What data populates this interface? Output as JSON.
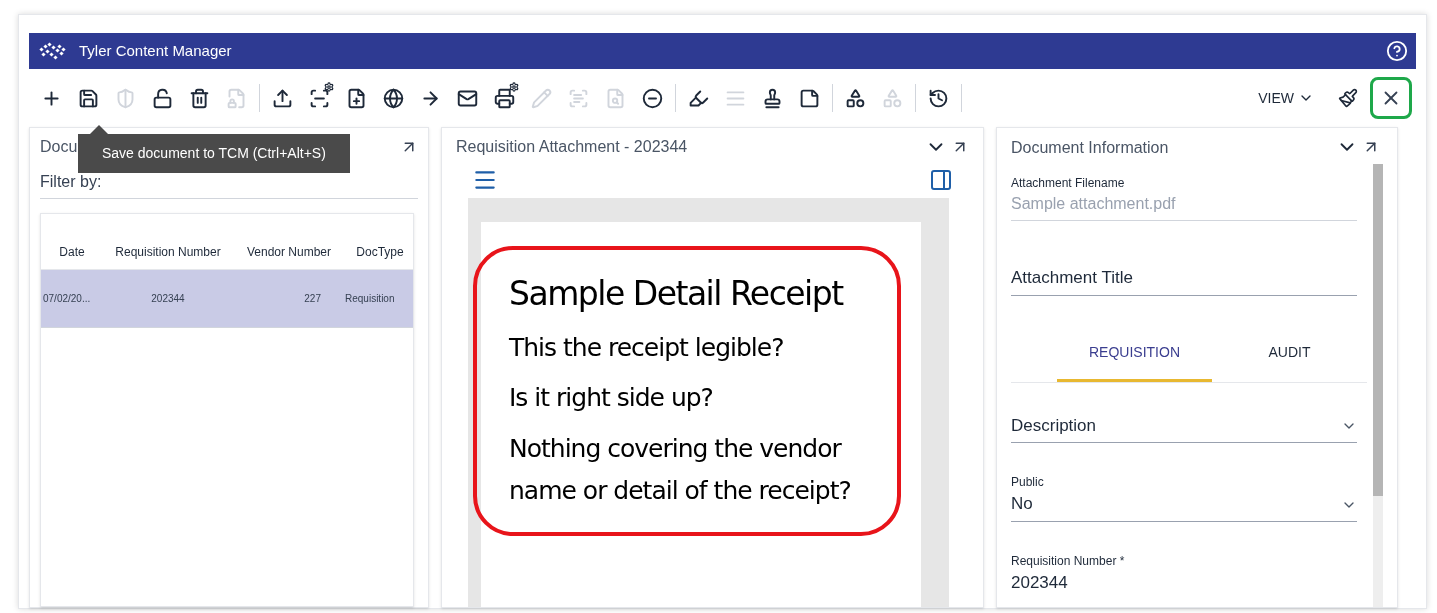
{
  "app": {
    "title": "Tyler Content Manager"
  },
  "toolbar": [
    {
      "kind": "add",
      "disabled": false
    },
    {
      "kind": "save",
      "disabled": false
    },
    {
      "kind": "shield",
      "disabled": true
    },
    {
      "kind": "unlock",
      "disabled": false
    },
    {
      "kind": "delete",
      "disabled": false
    },
    {
      "kind": "file-lock",
      "disabled": true
    },
    {
      "kind": "separator"
    },
    {
      "kind": "upload",
      "disabled": false
    },
    {
      "kind": "scan",
      "disabled": false
    },
    {
      "kind": "file-add",
      "disabled": false
    },
    {
      "kind": "globe",
      "disabled": false
    },
    {
      "kind": "arrow",
      "disabled": false
    },
    {
      "kind": "mail",
      "disabled": false
    },
    {
      "kind": "print",
      "disabled": false
    },
    {
      "kind": "pencil",
      "disabled": true
    },
    {
      "kind": "text-box",
      "disabled": true
    },
    {
      "kind": "search-doc",
      "disabled": true
    },
    {
      "kind": "minus",
      "disabled": false
    },
    {
      "kind": "separator"
    },
    {
      "kind": "marker",
      "disabled": false
    },
    {
      "kind": "lines",
      "disabled": true
    },
    {
      "kind": "stamp",
      "disabled": false
    },
    {
      "kind": "page",
      "disabled": false
    },
    {
      "kind": "separator"
    },
    {
      "kind": "shapes",
      "disabled": false
    },
    {
      "kind": "shapes",
      "disabled": true
    },
    {
      "kind": "separator"
    },
    {
      "kind": "history",
      "disabled": false
    },
    {
      "kind": "separator"
    }
  ],
  "view_menu": {
    "label": "VIEW"
  },
  "close_button": {
    "highlighted": true
  },
  "tooltip": {
    "text": "Save document to TCM (Ctrl+Alt+S)"
  },
  "left_panel": {
    "title": "Docu",
    "filter_label": "Filter by:",
    "table": {
      "columns": [
        "Date",
        "Requisition Number",
        "Vendor Number",
        "DocType"
      ],
      "rows": [
        {
          "cells": [
            "07/02/20...",
            "202344",
            "227",
            "Requisition"
          ],
          "selected": true
        }
      ]
    }
  },
  "viewer_panel": {
    "title": "Requisition Attachment - 202344",
    "document": {
      "heading": "Sample Detail Receipt",
      "lines": [
        "This the receipt legible?",
        "Is it right side up?",
        "Nothing covering the vendor name or detail of the receipt?"
      ],
      "highlighted": true
    }
  },
  "info_panel": {
    "title": "Document Information",
    "fields": [
      {
        "kind": "readonly",
        "label": "Attachment Filename",
        "value": "Sample attachment.pdf",
        "disabled": true
      },
      {
        "kind": "input",
        "placeholder": "Attachment Title"
      }
    ],
    "tabs": [
      {
        "label": "REQUISITION",
        "selected": true
      },
      {
        "label": "AUDIT",
        "selected": false
      }
    ],
    "tab_fields": [
      {
        "kind": "select",
        "placeholder": "Description"
      },
      {
        "kind": "select",
        "label": "Public",
        "value": "No"
      },
      {
        "kind": "text",
        "label": "Requisition Number *",
        "value": "202344"
      }
    ]
  }
}
